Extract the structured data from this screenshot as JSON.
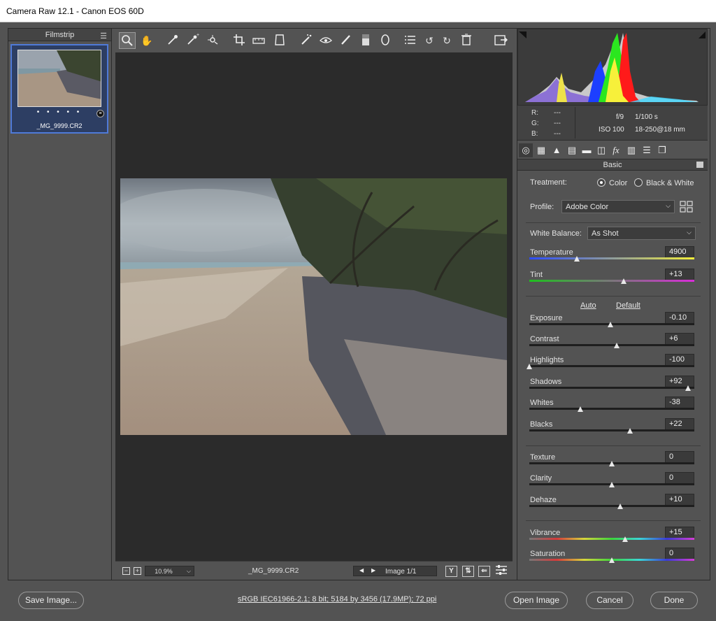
{
  "window": {
    "title": "Camera Raw 12.1  -  Canon EOS 60D"
  },
  "filmstrip": {
    "title": "Filmstrip",
    "thumbnail": {
      "filename": "_MG_9999.CR2",
      "rating_dots": "• • • • •"
    }
  },
  "toolbar": {
    "tools": [
      "zoom-tool",
      "hand-tool",
      "white-balance-tool",
      "color-sampler-tool",
      "targeted-adjustment-tool",
      "crop-tool",
      "straighten-tool",
      "transform-tool",
      "spot-removal-tool",
      "red-eye-tool",
      "adjustment-brush",
      "graduated-filter",
      "radial-filter",
      "presets-list",
      "rotate-ccw",
      "rotate-cw",
      "delete",
      "open-preferences"
    ]
  },
  "bottom": {
    "zoom": "10.9%",
    "filename": "_MG_9999.CR2",
    "image_counter": "Image 1/1"
  },
  "readout": {
    "r_label": "R:",
    "g_label": "G:",
    "b_label": "B:",
    "r": "---",
    "g": "---",
    "b": "---",
    "aperture": "f/9",
    "shutter": "1/100 s",
    "iso": "ISO 100",
    "lens": "18-250@18 mm"
  },
  "panel": {
    "section_title": "Basic",
    "treatment": {
      "label": "Treatment:",
      "option_color": "Color",
      "option_bw": "Black & White",
      "selected": "Color"
    },
    "profile": {
      "label": "Profile:",
      "value": "Adobe Color"
    },
    "white_balance": {
      "label": "White Balance:",
      "value": "As Shot"
    },
    "temperature": {
      "label": "Temperature",
      "value": "4900",
      "pos": 0.29
    },
    "tint": {
      "label": "Tint",
      "value": "+13",
      "pos": 0.57
    },
    "auto_label": "Auto",
    "default_label": "Default",
    "exposure": {
      "label": "Exposure",
      "value": "-0.10",
      "pos": 0.49
    },
    "contrast": {
      "label": "Contrast",
      "value": "+6",
      "pos": 0.53
    },
    "highlights": {
      "label": "Highlights",
      "value": "-100",
      "pos": 0.0
    },
    "shadows": {
      "label": "Shadows",
      "value": "+92",
      "pos": 0.96
    },
    "whites": {
      "label": "Whites",
      "value": "-38",
      "pos": 0.31
    },
    "blacks": {
      "label": "Blacks",
      "value": "+22",
      "pos": 0.61
    },
    "texture": {
      "label": "Texture",
      "value": "0",
      "pos": 0.5
    },
    "clarity": {
      "label": "Clarity",
      "value": "0",
      "pos": 0.5
    },
    "dehaze": {
      "label": "Dehaze",
      "value": "+10",
      "pos": 0.55
    },
    "vibrance": {
      "label": "Vibrance",
      "value": "+15",
      "pos": 0.58
    },
    "saturation": {
      "label": "Saturation",
      "value": "0",
      "pos": 0.5
    }
  },
  "footer": {
    "save": "Save Image...",
    "workflow": "sRGB IEC61966-2.1; 8 bit; 5184 by 3456 (17.9MP); 72 ppi",
    "open": "Open Image",
    "cancel": "Cancel",
    "done": "Done"
  }
}
